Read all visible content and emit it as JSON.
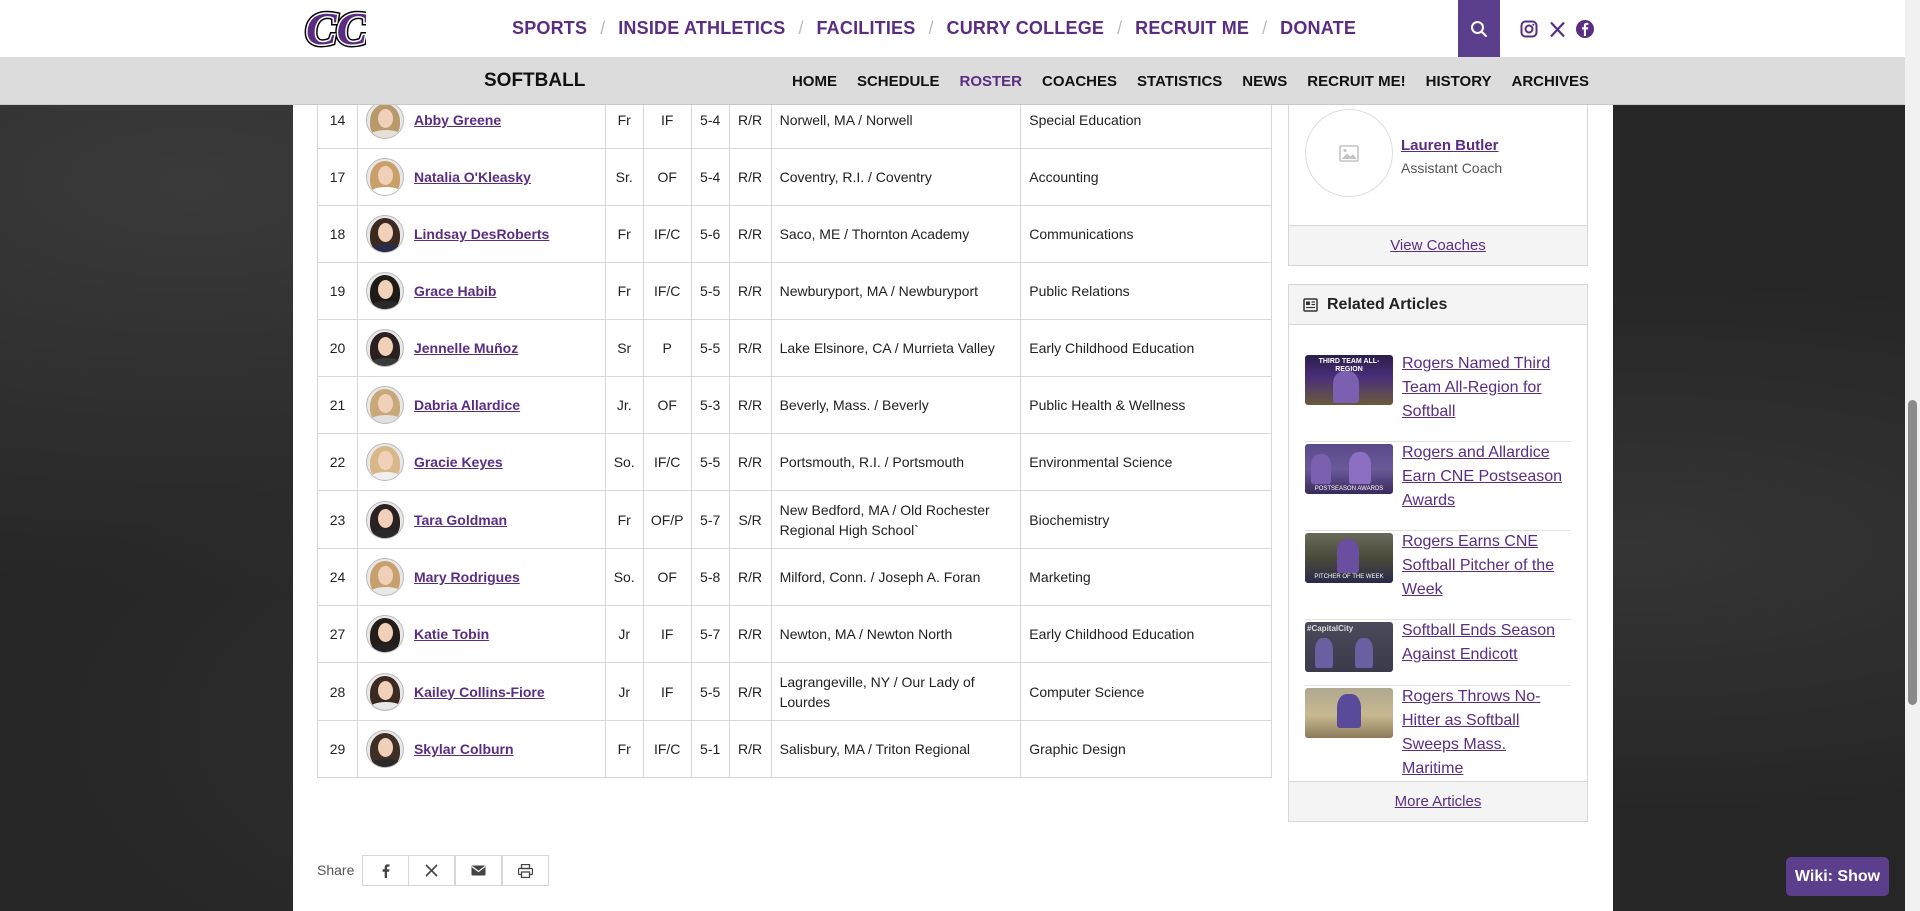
{
  "top_nav": {
    "logo_text": "CC",
    "items": [
      "SPORTS",
      "INSIDE ATHLETICS",
      "FACILITIES",
      "CURRY COLLEGE",
      "RECRUIT ME",
      "DONATE"
    ],
    "search_icon": "search-icon",
    "social_icons": [
      "instagram-icon",
      "x-icon",
      "facebook-icon"
    ]
  },
  "sub_nav": {
    "title": "SOFTBALL",
    "items": [
      "HOME",
      "SCHEDULE",
      "ROSTER",
      "COACHES",
      "STATISTICS",
      "NEWS",
      "RECRUIT ME!",
      "HISTORY",
      "ARCHIVES"
    ],
    "active": "ROSTER"
  },
  "roster": [
    {
      "num": "14",
      "name": "Abby Greene",
      "year": "Fr",
      "pos": "IF",
      "ht": "5-4",
      "bt": "R/R",
      "home": "Norwell, MA / Norwell",
      "major": "Special Education"
    },
    {
      "num": "17",
      "name": "Natalia O'Kleasky",
      "year": "Sr.",
      "pos": "OF",
      "ht": "5-4",
      "bt": "R/R",
      "home": "Coventry, R.I. / Coventry",
      "major": "Accounting"
    },
    {
      "num": "18",
      "name": "Lindsay DesRoberts",
      "year": "Fr",
      "pos": "IF/C",
      "ht": "5-6",
      "bt": "R/R",
      "home": "Saco, ME / Thornton Academy",
      "major": "Communications"
    },
    {
      "num": "19",
      "name": "Grace Habib",
      "year": "Fr",
      "pos": "IF/C",
      "ht": "5-5",
      "bt": "R/R",
      "home": "Newburyport, MA / Newburyport",
      "major": "Public Relations"
    },
    {
      "num": "20",
      "name": "Jennelle Muñoz",
      "year": "Sr",
      "pos": "P",
      "ht": "5-5",
      "bt": "R/R",
      "home": "Lake Elsinore, CA / Murrieta Valley",
      "major": "Early Childhood Education"
    },
    {
      "num": "21",
      "name": "Dabria Allardice",
      "year": "Jr.",
      "pos": "OF",
      "ht": "5-3",
      "bt": "R/R",
      "home": "Beverly, Mass. / Beverly",
      "major": "Public Health & Wellness"
    },
    {
      "num": "22",
      "name": "Gracie Keyes",
      "year": "So.",
      "pos": "IF/C",
      "ht": "5-5",
      "bt": "R/R",
      "home": "Portsmouth, R.I. / Portsmouth",
      "major": "Environmental Science"
    },
    {
      "num": "23",
      "name": "Tara Goldman",
      "year": "Fr",
      "pos": "OF/P",
      "ht": "5-7",
      "bt": "S/R",
      "home": "New Bedford, MA / Old Rochester Regional High School`",
      "major": "Biochemistry"
    },
    {
      "num": "24",
      "name": "Mary Rodrigues",
      "year": "So.",
      "pos": "OF",
      "ht": "5-8",
      "bt": "R/R",
      "home": "Milford, Conn. / Joseph A. Foran",
      "major": "Marketing"
    },
    {
      "num": "27",
      "name": "Katie Tobin",
      "year": "Jr",
      "pos": "IF",
      "ht": "5-7",
      "bt": "R/R",
      "home": "Newton, MA / Newton North",
      "major": "Early Childhood Education"
    },
    {
      "num": "28",
      "name": "Kailey Collins-Fiore",
      "year": "Jr",
      "pos": "IF",
      "ht": "5-5",
      "bt": "R/R",
      "home": "Lagrangeville, NY / Our Lady of Lourdes",
      "major": "Computer Science"
    },
    {
      "num": "29",
      "name": "Skylar Colburn",
      "year": "Fr",
      "pos": "IF/C",
      "ht": "5-1",
      "bt": "R/R",
      "home": "Salisbury, MA / Triton Regional",
      "major": "Graphic Design"
    }
  ],
  "coach_card": {
    "name": "Lauren Butler",
    "title": "Assistant Coach",
    "footer_link": "View Coaches"
  },
  "articles": {
    "heading": "Related Articles",
    "items": [
      {
        "title": "Rogers Named Third Team All-Region for Softball",
        "thumb_text": "THIRD TEAM ALL-REGION"
      },
      {
        "title": "Rogers and Allardice Earn CNE Postseason Awards",
        "thumb_text": "POSTSEASON AWARDS"
      },
      {
        "title": "Rogers Earns CNE Softball Pitcher of the Week",
        "thumb_text": "PITCHER OF THE WEEK"
      },
      {
        "title": "Softball Ends Season Against Endicott",
        "thumb_text": "#CapitalCity"
      },
      {
        "title": "Rogers Throws No-Hitter as Softball Sweeps Mass. Maritime",
        "thumb_text": ""
      }
    ],
    "footer_link": "More Articles"
  },
  "share": {
    "label": "Share",
    "buttons": [
      "facebook-icon",
      "x-icon",
      "email-icon",
      "print-icon"
    ]
  },
  "wiki_button": "Wiki: Show",
  "colors": {
    "brand_purple": "#5a2d82",
    "button_purple": "#5b3e8c",
    "subnav_gray": "#dcdcdc",
    "page_dark": "#262626"
  }
}
